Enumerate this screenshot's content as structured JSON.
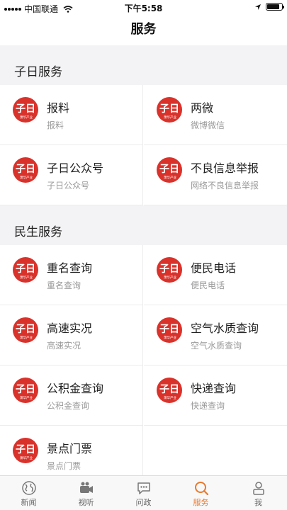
{
  "status_bar": {
    "carrier": "中国联通",
    "time": "下午5:58",
    "battery_level": 0.85
  },
  "nav": {
    "title": "服务"
  },
  "logo": {
    "char": "子日",
    "tag": "萧华产业"
  },
  "sections": [
    {
      "title": "子日服务",
      "items": [
        {
          "title": "报料",
          "subtitle": "报料"
        },
        {
          "title": "两微",
          "subtitle": "微博微信"
        },
        {
          "title": "子日公众号",
          "subtitle": "子日公众号"
        },
        {
          "title": "不良信息举报",
          "subtitle": "网络不良信息举报"
        }
      ]
    },
    {
      "title": "民生服务",
      "items": [
        {
          "title": "重名查询",
          "subtitle": "重名查询"
        },
        {
          "title": "便民电话",
          "subtitle": "便民电话"
        },
        {
          "title": "高速实况",
          "subtitle": "高速实况"
        },
        {
          "title": "空气水质查询",
          "subtitle": "空气水质查询"
        },
        {
          "title": "公积金查询",
          "subtitle": "公积金查询"
        },
        {
          "title": "快递查询",
          "subtitle": "快递查询"
        },
        {
          "title": "景点门票",
          "subtitle": "景点门票"
        }
      ]
    }
  ],
  "tabs": [
    {
      "label": "新闻",
      "icon": "globe-icon"
    },
    {
      "label": "视听",
      "icon": "video-camera-icon"
    },
    {
      "label": "问政",
      "icon": "chat-bubble-icon"
    },
    {
      "label": "服务",
      "icon": "search-icon",
      "active": true
    },
    {
      "label": "我",
      "icon": "person-icon"
    }
  ],
  "colors": {
    "accent": "#e8792e",
    "logo_red": "#d9322b"
  }
}
